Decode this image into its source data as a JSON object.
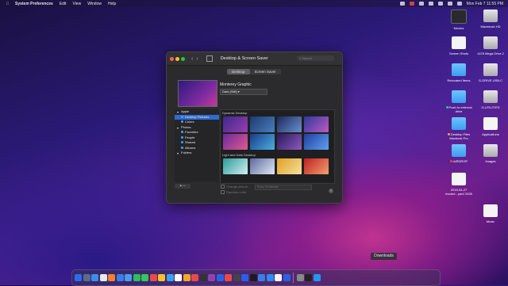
{
  "menubar": {
    "app_name": "System Preferences",
    "menus": [
      "Edit",
      "View",
      "Window",
      "Help"
    ],
    "datetime": "Mon Feb 7  11:55 PM"
  },
  "desktop_icons": [
    {
      "label": "Movies",
      "kind": "dark"
    },
    {
      "label": "Macintosh HD",
      "kind": "drive"
    },
    {
      "label": "Screen Shots",
      "kind": "doc"
    },
    {
      "label": "1478 Mega Drive 2",
      "kind": "drive"
    },
    {
      "label": "Relocated Items",
      "kind": "folder"
    },
    {
      "label": "G-DRIVE USB-C",
      "kind": "drive"
    },
    {
      "label": "Push to external drive",
      "kind": "folder",
      "tag": "#2ecc71"
    },
    {
      "label": "G-UTILITIES",
      "kind": "drive"
    },
    {
      "label": "Desktop Files Macbook Pro",
      "kind": "folder",
      "tag": "#f5a623"
    },
    {
      "label": "Applications",
      "kind": "doc"
    },
    {
      "label": "AIRDROP",
      "kind": "folder",
      "tag": "#e74c3c"
    },
    {
      "label": "Images",
      "kind": "drive"
    },
    {
      "label": "2019-04-27 invoice...yard 1028",
      "kind": "doc"
    },
    {
      "label": "Music",
      "kind": "doc"
    }
  ],
  "window": {
    "title": "Desktop & Screen Saver",
    "search_placeholder": "Search",
    "tabs": [
      "Desktop",
      "Screen Saver"
    ],
    "wallpaper_name": "Monterey Graphic",
    "appearance_value": "Dark (Still)",
    "sidebar": [
      {
        "label": "Apple",
        "level": 0,
        "sel": false
      },
      {
        "label": "Desktop Pictures",
        "level": 1,
        "sel": true
      },
      {
        "label": "Colors",
        "level": 1,
        "sel": false
      },
      {
        "label": "Photos",
        "level": 0,
        "sel": false
      },
      {
        "label": "Favorites",
        "level": 1,
        "sel": false
      },
      {
        "label": "People",
        "level": 1,
        "sel": false
      },
      {
        "label": "Shared",
        "level": 1,
        "sel": false
      },
      {
        "label": "Albums",
        "level": 1,
        "sel": false
      },
      {
        "label": "Folders",
        "level": 0,
        "sel": false
      }
    ],
    "section_dynamic": "Dynamic Desktop",
    "section_light_dark": "Light and Dark Desktop",
    "add_remove": "+  −",
    "change_picture": "Change picture:",
    "every_value": "Every 30 minutes",
    "random_order": "Random order",
    "help": "?"
  },
  "dock": {
    "tooltip": "Downloads",
    "apps": [
      "#2a6de8",
      "#5b6b8c",
      "#3a8ee6",
      "#e8e8e8",
      "#f0822c",
      "#3b7de8",
      "#4c9be8",
      "#2cbf5a",
      "#34c759",
      "#e84a4a",
      "#f5c02c",
      "#3aa0f0",
      "#ffffff",
      "#f5a623",
      "#e84a4a",
      "#333333",
      "#8e44ad",
      "#2c5fe8",
      "#e84a4a",
      "#444444",
      "#2c5fe8",
      "#1c1c1c",
      "#3b7de8",
      "#2d8cf0",
      "#f5f5f5",
      "#2c5fe8",
      "#888888",
      "#222222",
      "#2196f3"
    ]
  }
}
